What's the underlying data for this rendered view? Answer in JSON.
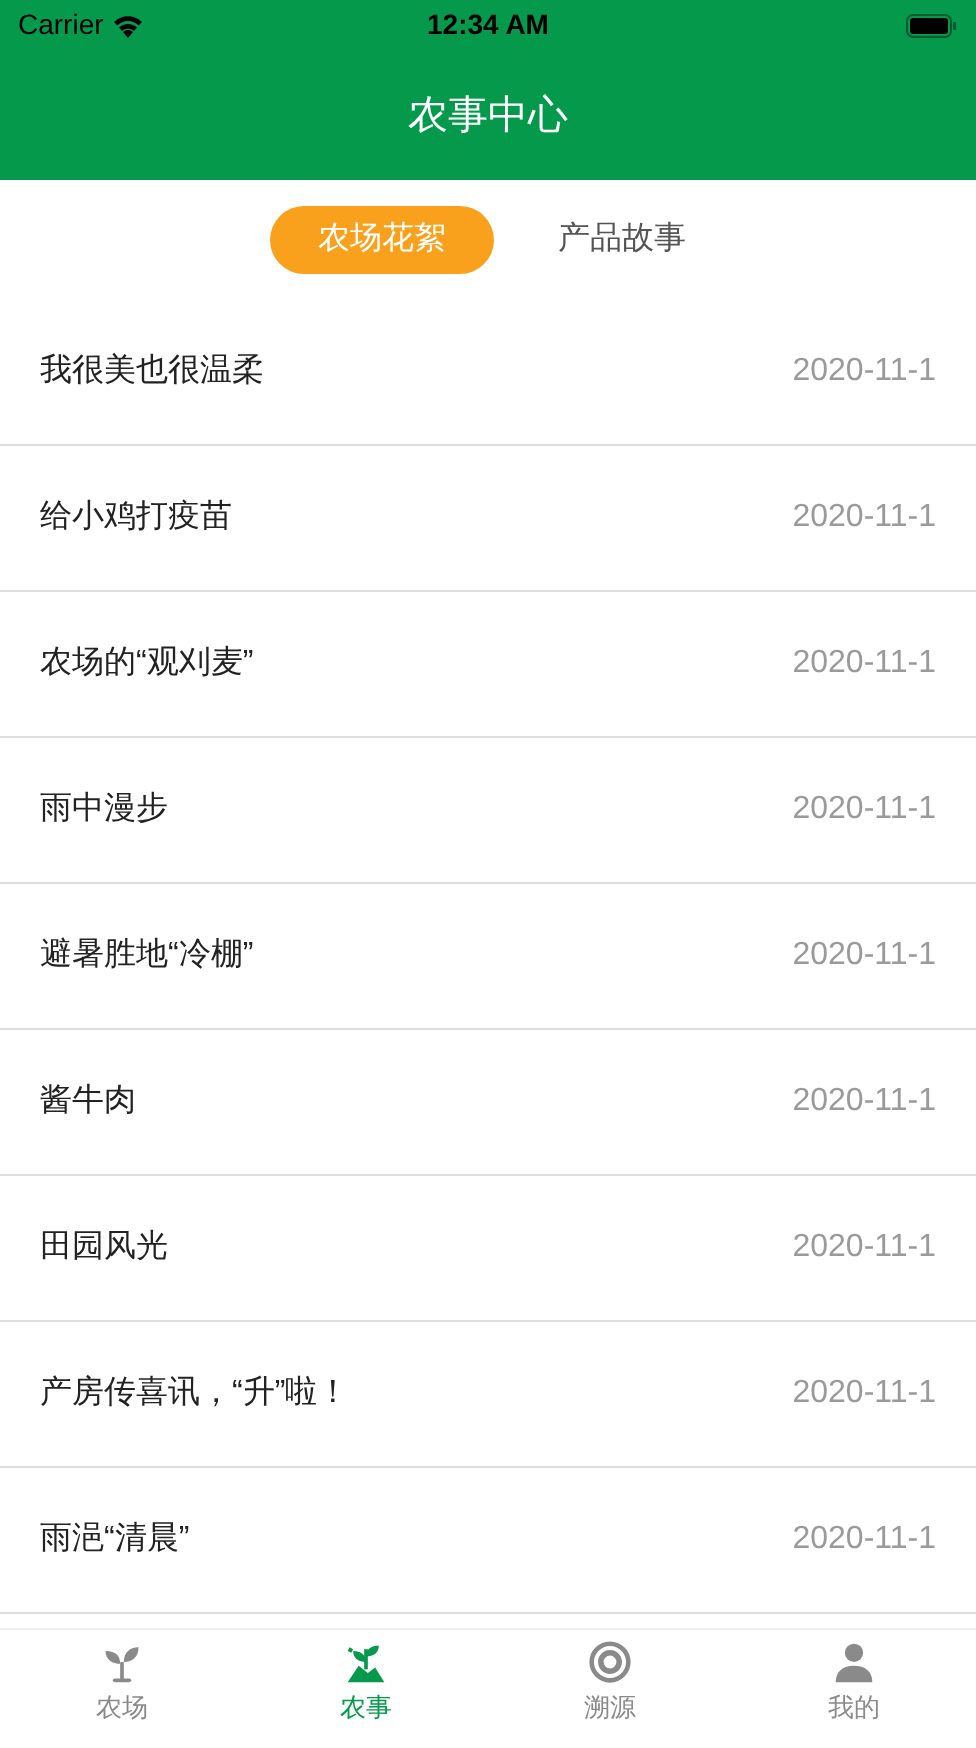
{
  "status_bar": {
    "carrier": "Carrier",
    "time": "12:34 AM"
  },
  "header": {
    "title": "农事中心"
  },
  "tabs": [
    {
      "label": "农场花絮",
      "selected": true
    },
    {
      "label": "产品故事",
      "selected": false
    }
  ],
  "list": [
    {
      "title": "我很美也很温柔",
      "date": "2020-11-1"
    },
    {
      "title": "给小鸡打疫苗",
      "date": "2020-11-1"
    },
    {
      "title": "农场的“观刈麦”",
      "date": "2020-11-1"
    },
    {
      "title": "雨中漫步",
      "date": "2020-11-1"
    },
    {
      "title": "避暑胜地“冷棚”",
      "date": "2020-11-1"
    },
    {
      "title": "酱牛肉",
      "date": "2020-11-1"
    },
    {
      "title": "田园风光",
      "date": "2020-11-1"
    },
    {
      "title": "产房传喜讯，“升”啦！",
      "date": "2020-11-1"
    },
    {
      "title": "雨浥“清晨”",
      "date": "2020-11-1"
    }
  ],
  "tab_bar": [
    {
      "kind": "farm",
      "label": "农场",
      "selected": false
    },
    {
      "kind": "work",
      "label": "农事",
      "selected": true
    },
    {
      "kind": "trace",
      "label": "溯源",
      "selected": false
    },
    {
      "kind": "me",
      "label": "我的",
      "selected": false
    }
  ]
}
